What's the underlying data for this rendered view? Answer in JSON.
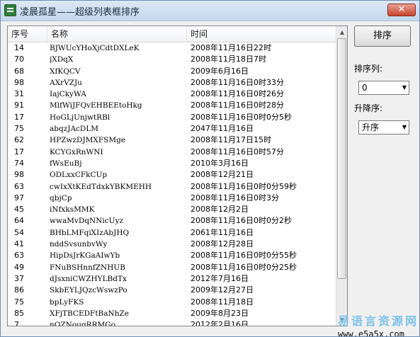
{
  "window": {
    "title": "凌晨孤星——超级列表框排序",
    "close_glyph": "✕"
  },
  "list": {
    "columns": [
      "序号",
      "名称",
      "时间"
    ],
    "rows": [
      [
        "14",
        "BJWUcYHoXjCdtDXLeK",
        "2008年11月16日22时"
      ],
      [
        "70",
        "jXDqX",
        "2008年11月18日7时"
      ],
      [
        "68",
        "XfKQCV",
        "2009年6月16日"
      ],
      [
        "98",
        "AXrVZJu",
        "2008年11月16日0时33分"
      ],
      [
        "31",
        "IajCkyWA",
        "2008年11月16日0时26分"
      ],
      [
        "91",
        "MlfWiJFQvEHBEEtoHkg",
        "2008年11月16日0时28分"
      ],
      [
        "17",
        "HoGLjUnjwtRBl",
        "2008年11月16日0时0分5秒"
      ],
      [
        "75",
        "abqzJAcDLM",
        "2047年11月16日"
      ],
      [
        "62",
        "HPZwzDJMXFSMge",
        "2008年11月17日15时"
      ],
      [
        "17",
        "KCYGxRnWNI",
        "2008年11月16日0时57分"
      ],
      [
        "74",
        "fWsEuBj",
        "2010年3月16日"
      ],
      [
        "98",
        "ODLxxCFkCUp",
        "2008年12月21日"
      ],
      [
        "63",
        "cwIxXtKEdTdxkYBKMEHH",
        "2008年11月16日0时0分59秒"
      ],
      [
        "97",
        "qbjCp",
        "2008年11月16日0时3分"
      ],
      [
        "45",
        "iNfxksMMK",
        "2008年12月2日"
      ],
      [
        "64",
        "wwaMvDqNNicUyz",
        "2008年11月16日0时0分2秒"
      ],
      [
        "54",
        "BHbLMFqiXIzAbJHQ",
        "2061年11月16日"
      ],
      [
        "41",
        "nddSvsunbvWy",
        "2008年12月28日"
      ],
      [
        "63",
        "HipDsJrKGaAIwYb",
        "2008年11月16日0时0分55秒"
      ],
      [
        "49",
        "FNuBSHnnfZNHUB",
        "2008年11月16日0时0分25秒"
      ],
      [
        "37",
        "dJsxniCWZHYLBdTx",
        "2012年7月16日"
      ],
      [
        "86",
        "SkbEYLJQzcWswzPo",
        "2009年12月27日"
      ],
      [
        "75",
        "bpLyFKS",
        "2008年11月18日"
      ],
      [
        "85",
        "XFjTBCEDFtBaNhZe",
        "2009年8月23日"
      ],
      [
        "7",
        "nOZNougRRMGo",
        "2012年2月16日"
      ]
    ]
  },
  "controls": {
    "sort_button": "排序",
    "sort_column_label": "排序列:",
    "sort_column_value": "0",
    "order_label": "升降序:",
    "order_value": "升序"
  },
  "watermark": {
    "line1": "易语言资源网",
    "line2": "www.e5a5x.com"
  },
  "colors": {
    "titlebar_bg": "#c4d7ec",
    "close_button": "#c7432d",
    "window_bg": "#f0f0f0",
    "watermark_text": "#7ec2e8"
  }
}
